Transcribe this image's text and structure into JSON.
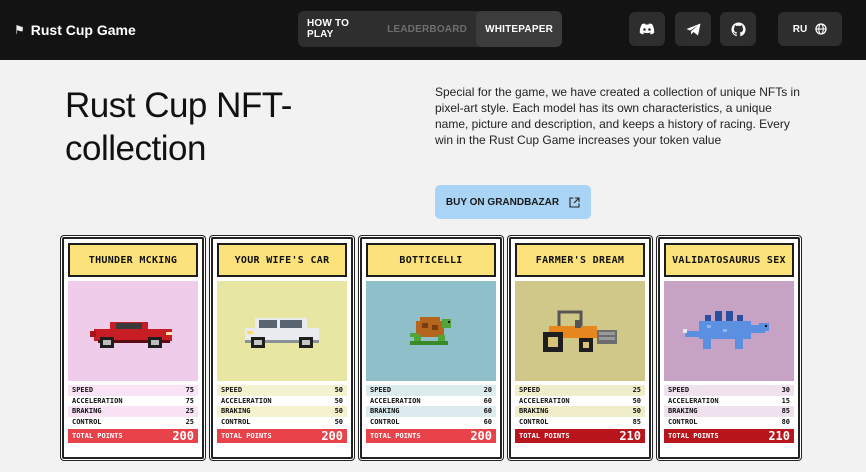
{
  "header": {
    "brand": "Rust Cup Game",
    "nav": [
      {
        "label": "HOW TO PLAY",
        "state": "normal"
      },
      {
        "label": "LEADERBOARD",
        "state": "disabled"
      },
      {
        "label": "WHITEPAPER",
        "state": "active"
      }
    ],
    "icons": [
      "discord-icon",
      "telegram-icon",
      "github-icon"
    ],
    "lang": "RU"
  },
  "hero": {
    "title": "Rust Cup NFT-collection",
    "description": "Special for the game, we have created a collection of unique NFTs in pixel-art style. Each model has its own characteristics, a unique name, picture and description, and keeps a history of racing. Every win in the Rust Cup Game increases your token value",
    "buy_label": "BUY ON GRANDBAZAR"
  },
  "stat_labels": [
    "SPEED",
    "ACCELERATION",
    "BRAKING",
    "CONTROL"
  ],
  "total_label": "TOTAL POINTS",
  "cards": [
    {
      "name": "THUNDER MCKING",
      "art": "sports-car",
      "art_bg": "#efcdea",
      "stats": [
        75,
        75,
        25,
        25
      ],
      "total": 200,
      "tint": "#f9e3f5",
      "total_color": "#e8424a"
    },
    {
      "name": "YOUR WIFE'S CAR",
      "art": "hatchback-car",
      "art_bg": "#e7e6a2",
      "stats": [
        50,
        50,
        50,
        50
      ],
      "total": 200,
      "tint": "#f4f2cf",
      "total_color": "#e8424a"
    },
    {
      "name": "BOTTICELLI",
      "art": "turtle",
      "art_bg": "#8fbfc9",
      "stats": [
        20,
        60,
        60,
        60
      ],
      "total": 200,
      "tint": "#dcebee",
      "total_color": "#e8424a"
    },
    {
      "name": "FARMER'S DREAM",
      "art": "tractor",
      "art_bg": "#cfc889",
      "stats": [
        25,
        50,
        50,
        85
      ],
      "total": 210,
      "tint": "#f0edcb",
      "total_color": "#b8141c"
    },
    {
      "name": "VALIDATOSAURUS SEX",
      "art": "stegosaurus",
      "art_bg": "#c6a2c4",
      "stats": [
        30,
        15,
        85,
        80
      ],
      "total": 210,
      "tint": "#efe1ee",
      "total_color": "#b8141c"
    }
  ]
}
